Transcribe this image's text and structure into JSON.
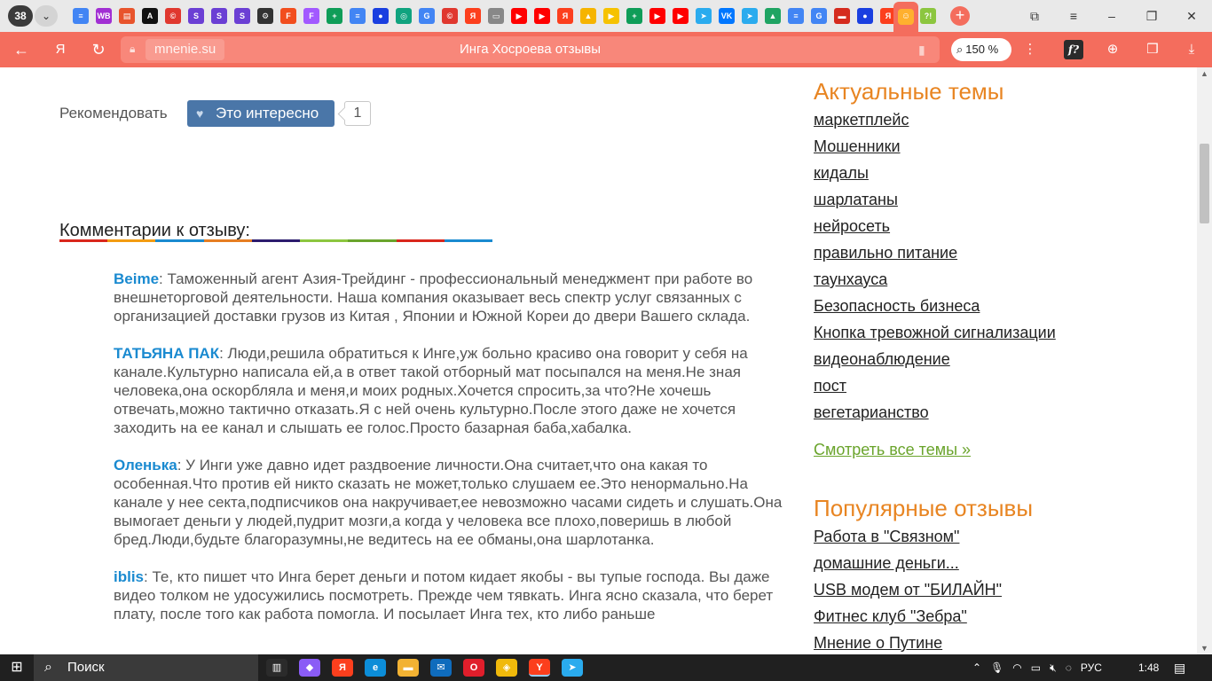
{
  "browser": {
    "tab_count": "38",
    "tab_icons": [
      {
        "name": "docs",
        "glyph": "≡",
        "color": "#4285f4"
      },
      {
        "name": "wildberries",
        "glyph": "WB",
        "color": "#a12fd3"
      },
      {
        "name": "store",
        "glyph": "▤",
        "color": "#e8542c"
      },
      {
        "name": "a-letter",
        "glyph": "A",
        "color": "#111111"
      },
      {
        "name": "copyright",
        "glyph": "©",
        "color": "#e0382f"
      },
      {
        "name": "s-app-1",
        "glyph": "S",
        "color": "#6b3fd4"
      },
      {
        "name": "s-app-2",
        "glyph": "S",
        "color": "#6b3fd4"
      },
      {
        "name": "s-app-3",
        "glyph": "S",
        "color": "#6b3fd4"
      },
      {
        "name": "gear",
        "glyph": "⚙",
        "color": "#333333"
      },
      {
        "name": "figma-1",
        "glyph": "F",
        "color": "#f24e1e"
      },
      {
        "name": "figma-2",
        "glyph": "F",
        "color": "#a259ff"
      },
      {
        "name": "sheets-1",
        "glyph": "+",
        "color": "#0f9d58"
      },
      {
        "name": "docs-2",
        "glyph": "≡",
        "color": "#4285f4"
      },
      {
        "name": "dot-blue",
        "glyph": "●",
        "color": "#1a3fe0"
      },
      {
        "name": "chatgpt",
        "glyph": "◎",
        "color": "#10a37f"
      },
      {
        "name": "google-1",
        "glyph": "G",
        "color": "#4285f4"
      },
      {
        "name": "copyright-2",
        "glyph": "©",
        "color": "#e0382f"
      },
      {
        "name": "yandex-1",
        "glyph": "Я",
        "color": "#fc3f1d"
      },
      {
        "name": "chat",
        "glyph": "▭",
        "color": "#888888"
      },
      {
        "name": "youtube-1",
        "glyph": "▶",
        "color": "#ff0000"
      },
      {
        "name": "youtube-2",
        "glyph": "▶",
        "color": "#ff0000"
      },
      {
        "name": "yandex-2",
        "glyph": "Я",
        "color": "#fc3f1d"
      },
      {
        "name": "photos",
        "glyph": "▲",
        "color": "#f6b400"
      },
      {
        "name": "play-yellow",
        "glyph": "▶",
        "color": "#f6c200"
      },
      {
        "name": "sheets-2",
        "glyph": "+",
        "color": "#0f9d58"
      },
      {
        "name": "youtube-3",
        "glyph": "▶",
        "color": "#ff0000"
      },
      {
        "name": "youtube-4",
        "glyph": "▶",
        "color": "#ff0000"
      },
      {
        "name": "telegram-1",
        "glyph": "➤",
        "color": "#2aabee"
      },
      {
        "name": "vk",
        "glyph": "VK",
        "color": "#0077ff"
      },
      {
        "name": "telegram-2",
        "glyph": "➤",
        "color": "#2aabee"
      },
      {
        "name": "drive",
        "glyph": "▲",
        "color": "#1fa463"
      },
      {
        "name": "docs-3",
        "glyph": "≡",
        "color": "#4285f4"
      },
      {
        "name": "google-2",
        "glyph": "G",
        "color": "#4285f4"
      },
      {
        "name": "flag",
        "glyph": "▬",
        "color": "#d52b1e"
      },
      {
        "name": "dot-blue-2",
        "glyph": "●",
        "color": "#1a3fe0"
      },
      {
        "name": "yandex-3",
        "glyph": "Я",
        "color": "#fc3f1d"
      }
    ],
    "active_tab_glyph": "☺",
    "after_tab_glyph": "?!",
    "new_tab_glyph": "+",
    "url_domain": "mnenie.su",
    "page_title": "Инга Хосроева отзывы",
    "zoom": "150 %",
    "fx_label": "f?"
  },
  "page": {
    "recommend_label": "Рекомендовать",
    "interest_button": "Это интересно",
    "interest_count": "1",
    "comments_heading": "Комментарии к отзыву:",
    "underline_colors": [
      "#d9261c",
      "#f39c12",
      "#1a8ad0",
      "#e67e22",
      "#2c1c6e",
      "#8cc63f",
      "#6aa42c",
      "#d9261c",
      "#1a8ad0"
    ],
    "comments": [
      {
        "author": "Beime",
        "text": ": Таможенный агент Азия-Трейдинг - профессиональный менеджмент при работе во внешнеторговой деятельности. Наша компания оказывает весь спектр услуг связанных с организацией доставки грузов из Китая , Японии и Южной Кореи до двери Вашего склада."
      },
      {
        "author": "ТАТЬЯНА ПАК",
        "text": ": Люди,решила обратиться к Инге,уж больно красиво она говорит у себя на канале.Культурно написала ей,а в ответ такой отборный мат посыпался на меня.Не зная человека,она оскорбляла и меня,и моих родных.Хочется спросить,за что?Не хочешь отвечать,можно тактично отказать.Я с ней очень культурно.После этого даже не хочется заходить на ее канал и слышать ее голос.Просто базарная баба,хабалка."
      },
      {
        "author": "Оленька",
        "text": ": У Инги уже давно идет раздвоение личности.Она считает,что она какая то особенная.Что против ей никто сказать не может,только слушаем ее.Это ненормально.На канале у нее секта,подписчиков она накручивает,ее невозможно часами сидеть и слушать.Она вымогает деньги у людей,пудрит мозги,а когда у человека все плохо,поверишь в любой бред.Люди,будьте благоразумны,не ведитесь на ее обманы,она шарлотанка."
      },
      {
        "author": "iblis",
        "text": ": Те, кто пишет что Инга берет деньги и потом кидает якобы - вы тупые господа. Вы даже видео толком не удосужились посмотреть. Прежде чем тявкать. Инга ясно сказала, что берет плату, после того как работа помогла. И посылает Инга тех, кто либо раньше"
      }
    ]
  },
  "sidebar": {
    "topics_title": "Актуальные темы",
    "topics": [
      "маркетплейс",
      "Мошенники",
      "кидалы",
      "шарлатаны",
      "нейросеть",
      "правильно питание",
      "таунхауса",
      "Безопасность бизнеса",
      "Кнопка тревожной сигнализации",
      "видеонаблюдение",
      "пост",
      "вегетарианство"
    ],
    "see_all": "Смотреть все темы »",
    "popular_title": "Популярные отзывы",
    "popular": [
      "Работа в \"Связном\"",
      "домашние деньги...",
      "USB модем от \"БИЛАЙН\"",
      "Фитнес клуб \"Зебра\"",
      "Мнение о Путине"
    ]
  },
  "taskbar": {
    "search_label": "Поиск",
    "apps": [
      {
        "name": "explorer-view",
        "glyph": "▥",
        "color": "#2b2b2b"
      },
      {
        "name": "alice",
        "glyph": "◆",
        "color": "#8a5cf6"
      },
      {
        "name": "yandex-browser",
        "glyph": "Я",
        "color": "#fc3f1d"
      },
      {
        "name": "edge",
        "glyph": "e",
        "color": "#0c8dd8"
      },
      {
        "name": "files",
        "glyph": "▬",
        "color": "#f2b233"
      },
      {
        "name": "mail",
        "glyph": "✉",
        "color": "#0f6cbd"
      },
      {
        "name": "opera",
        "glyph": "O",
        "color": "#e01e2b"
      },
      {
        "name": "binance",
        "glyph": "◈",
        "color": "#f0b90b"
      },
      {
        "name": "yandex-active",
        "glyph": "Y",
        "color": "#fc3f1d"
      },
      {
        "name": "telegram",
        "glyph": "➤",
        "color": "#2aabee"
      }
    ],
    "lang": "РУС",
    "time": "1:48"
  },
  "colors": {
    "accent": "#f46d5d",
    "link_blue": "#1a8ad0",
    "topic_orange": "#e88522",
    "see_all_green": "#6aa42c",
    "vk_button": "#4a76a8"
  }
}
